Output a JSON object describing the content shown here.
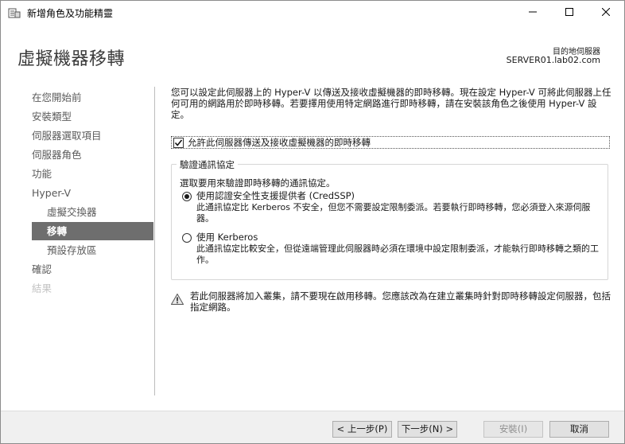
{
  "window": {
    "title": "新增角色及功能精靈",
    "minimize_icon": "minimize-icon",
    "maximize_icon": "maximize-icon",
    "close_icon": "close-icon"
  },
  "header": {
    "page_title": "虛擬機器移轉",
    "dest_label": "目的地伺服器",
    "dest_server": "SERVER01.lab02.com"
  },
  "nav": {
    "items": [
      {
        "label": "在您開始前",
        "state": "normal"
      },
      {
        "label": "安裝類型",
        "state": "normal"
      },
      {
        "label": "伺服器選取項目",
        "state": "normal"
      },
      {
        "label": "伺服器角色",
        "state": "normal"
      },
      {
        "label": "功能",
        "state": "normal"
      },
      {
        "label": "Hyper-V",
        "state": "normal"
      },
      {
        "label": "虛擬交換器",
        "state": "sub"
      },
      {
        "label": "移轉",
        "state": "active"
      },
      {
        "label": "預設存放區",
        "state": "sub"
      },
      {
        "label": "確認",
        "state": "normal"
      },
      {
        "label": "結果",
        "state": "disabled"
      }
    ]
  },
  "content": {
    "intro": "您可以設定此伺服器上的 Hyper-V 以傳送及接收虛擬機器的即時移轉。現在設定 Hyper-V 可將此伺服器上任何可用的網路用於即時移轉。若要擇用使用特定網路進行即時移轉，請在安裝該角色之後使用 Hyper-V 設定。",
    "allow_checkbox": {
      "label": "允許此伺服器傳送及接收虛擬機器的即時移轉",
      "checked": true
    },
    "auth_group": {
      "legend": "驗證通訊協定",
      "prompt": "選取要用來驗證即時移轉的通訊協定。",
      "options": [
        {
          "title": "使用認證安全性支援提供者 (CredSSP)",
          "description": "此通訊協定比 Kerberos 不安全，但您不需要設定限制委派。若要執行即時移轉，您必須登入來源伺服器。",
          "selected": true
        },
        {
          "title": "使用 Kerberos",
          "description": "此通訊協定比較安全，但從遠端管理此伺服器時必須在環境中設定限制委派，才能執行即時移轉之類的工作。",
          "selected": false
        }
      ]
    },
    "warning": {
      "icon": "warning-icon",
      "text": "若此伺服器將加入叢集，請不要現在啟用移轉。您應該改為在建立叢集時針對即時移轉設定伺服器，包括指定網路。"
    }
  },
  "footer": {
    "prev": "< 上一步(P)",
    "next": "下一步(N) >",
    "install": "安裝(I)",
    "cancel": "取消"
  },
  "colors": {
    "nav_active_bg": "#6e6e6e",
    "nav_text": "#5a5a5a",
    "nav_disabled": "#c4c4c4",
    "footer_bg": "#f0f0f0"
  }
}
